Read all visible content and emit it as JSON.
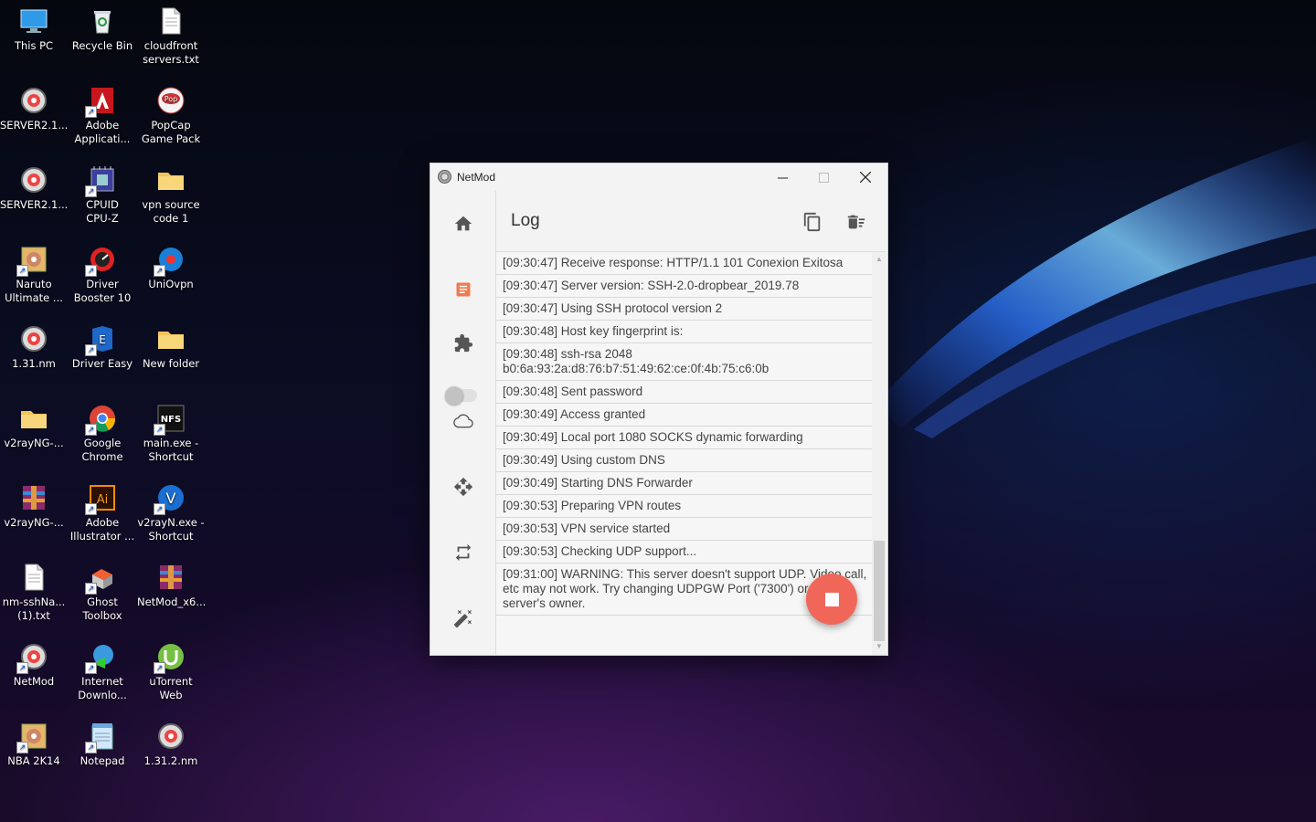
{
  "desktop": {
    "icons": [
      {
        "label": "This PC",
        "icon": "computer-icon"
      },
      {
        "label": "Recycle Bin",
        "icon": "recycle-bin-icon"
      },
      {
        "label": "cloudfront\nservers.txt",
        "icon": "text-file-icon"
      },
      {
        "label": "SERVER2.1...",
        "icon": "netmod-config-icon"
      },
      {
        "label": "Adobe\nApplicati...",
        "icon": "adobe-icon"
      },
      {
        "label": "PopCap\nGame Pack",
        "icon": "popcap-icon"
      },
      {
        "label": "SERVER2.1...",
        "icon": "netmod-config-icon"
      },
      {
        "label": "CPUID\nCPU-Z",
        "icon": "cpuz-icon"
      },
      {
        "label": "vpn source\ncode 1",
        "icon": "folder-icon"
      },
      {
        "label": "Naruto\nUltimate ...",
        "icon": "game-icon"
      },
      {
        "label": "Driver\nBooster 10",
        "icon": "driver-booster-icon"
      },
      {
        "label": "UniOvpn",
        "icon": "uniovpn-icon"
      },
      {
        "label": "1.31.nm",
        "icon": "netmod-config-icon"
      },
      {
        "label": "Driver Easy",
        "icon": "driver-easy-icon"
      },
      {
        "label": "New folder",
        "icon": "folder-icon"
      },
      {
        "label": "v2rayNG-...",
        "icon": "folder-icon"
      },
      {
        "label": "Google\nChrome",
        "icon": "chrome-icon"
      },
      {
        "label": "main.exe -\nShortcut",
        "icon": "nfs-icon"
      },
      {
        "label": "v2rayNG-...",
        "icon": "archive-icon"
      },
      {
        "label": "Adobe\nIllustrator ...",
        "icon": "illustrator-icon"
      },
      {
        "label": "v2rayN.exe -\nShortcut",
        "icon": "v2rayn-icon"
      },
      {
        "label": "nm-sshNa...\n(1).txt",
        "icon": "text-file-icon"
      },
      {
        "label": "Ghost\nToolbox",
        "icon": "ghost-toolbox-icon"
      },
      {
        "label": "NetMod_x6...",
        "icon": "archive-icon"
      },
      {
        "label": "NetMod",
        "icon": "netmod-app-icon"
      },
      {
        "label": "Internet\nDownlo...",
        "icon": "idm-icon"
      },
      {
        "label": "uTorrent Web",
        "icon": "utorrent-icon"
      },
      {
        "label": "NBA 2K14",
        "icon": "game-icon"
      },
      {
        "label": "Notepad",
        "icon": "notepad-icon"
      },
      {
        "label": "1.31.2.nm",
        "icon": "netmod-config-icon"
      }
    ]
  },
  "window": {
    "title": "NetMod",
    "header": {
      "title": "Log"
    },
    "colors": {
      "accent": "#f0675a",
      "sidebar_log": "#f07a52"
    },
    "log": [
      "[09:30:47] Receive response: HTTP/1.1 101 Conexion Exitosa",
      "[09:30:47] Server version: SSH-2.0-dropbear_2019.78",
      "[09:30:47] Using SSH protocol version 2",
      "[09:30:48] Host key fingerprint is:",
      "[09:30:48] ssh-rsa 2048\nb0:6a:93:2a:d8:76:b7:51:49:62:ce:0f:4b:75:c6:0b",
      "[09:30:48] Sent password",
      "[09:30:49] Access granted",
      "[09:30:49] Local port 1080 SOCKS dynamic forwarding",
      "[09:30:49] Using custom DNS",
      "[09:30:49] Starting DNS Forwarder",
      "[09:30:53] Preparing VPN routes",
      "[09:30:53] VPN service started",
      "[09:30:53] Checking UDP support...",
      "[09:31:00] WARNING: This server doesn't support UDP. Video call, etc may not work. Try changing UDPGW Port ('7300') or contact server's owner."
    ]
  }
}
